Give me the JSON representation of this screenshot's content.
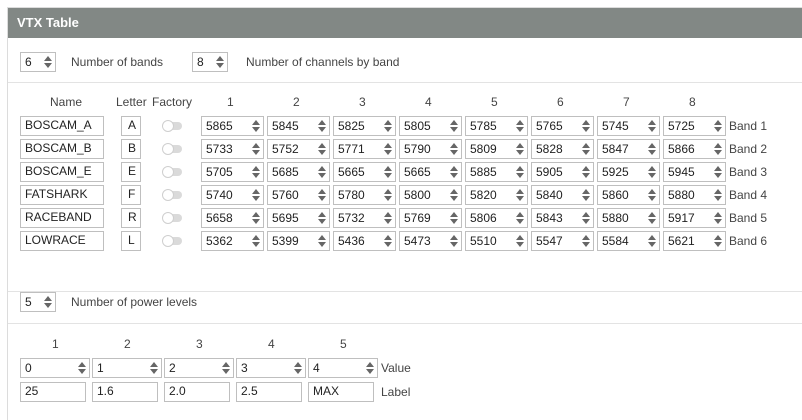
{
  "header": {
    "title": "VTX Table"
  },
  "controls": {
    "bands_value": "6",
    "bands_label": "Number of bands",
    "channels_value": "8",
    "channels_label": "Number of channels by band"
  },
  "table": {
    "headers": {
      "name": "Name",
      "letter": "Letter",
      "factory": "Factory",
      "channels": [
        "1",
        "2",
        "3",
        "4",
        "5",
        "6",
        "7",
        "8"
      ]
    },
    "bands": [
      {
        "name": "BOSCAM_A",
        "letter": "A",
        "freqs": [
          "5865",
          "5845",
          "5825",
          "5805",
          "5785",
          "5765",
          "5745",
          "5725"
        ],
        "label": "Band 1"
      },
      {
        "name": "BOSCAM_B",
        "letter": "B",
        "freqs": [
          "5733",
          "5752",
          "5771",
          "5790",
          "5809",
          "5828",
          "5847",
          "5866"
        ],
        "label": "Band 2"
      },
      {
        "name": "BOSCAM_E",
        "letter": "E",
        "freqs": [
          "5705",
          "5685",
          "5665",
          "5665",
          "5885",
          "5905",
          "5925",
          "5945"
        ],
        "label": "Band 3"
      },
      {
        "name": "FATSHARK",
        "letter": "F",
        "freqs": [
          "5740",
          "5760",
          "5780",
          "5800",
          "5820",
          "5840",
          "5860",
          "5880"
        ],
        "label": "Band 4"
      },
      {
        "name": "RACEBAND",
        "letter": "R",
        "freqs": [
          "5658",
          "5695",
          "5732",
          "5769",
          "5806",
          "5843",
          "5880",
          "5917"
        ],
        "label": "Band 5"
      },
      {
        "name": "LOWRACE",
        "letter": "L",
        "freqs": [
          "5362",
          "5399",
          "5436",
          "5473",
          "5510",
          "5547",
          "5584",
          "5621"
        ],
        "label": "Band 6"
      }
    ]
  },
  "power": {
    "levels_value": "5",
    "levels_label": "Number of power levels",
    "headers": [
      "1",
      "2",
      "3",
      "4",
      "5"
    ],
    "values": [
      "0",
      "1",
      "2",
      "3",
      "4"
    ],
    "value_label": "Value",
    "labels": [
      "25",
      "1.6",
      "2.0",
      "2.5",
      "MAX"
    ],
    "label_label": "Label"
  }
}
